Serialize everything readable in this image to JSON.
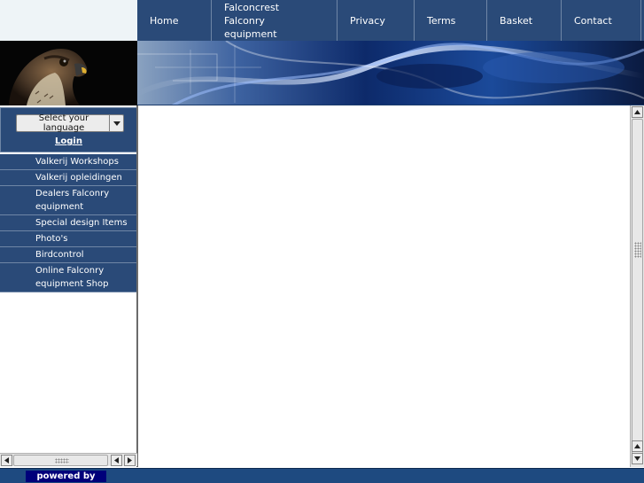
{
  "nav": {
    "items": [
      {
        "label": "Home"
      },
      {
        "label": "Falconcrest Falconry equipment",
        "lines": [
          "Falconcrest",
          "Falconry",
          "equipment"
        ]
      },
      {
        "label": "Privacy"
      },
      {
        "label": "Terms"
      },
      {
        "label": "Basket"
      },
      {
        "label": "Contact"
      }
    ]
  },
  "language": {
    "select_label": "Select your language",
    "login_label": "Login"
  },
  "sidebar": {
    "items": [
      {
        "label": "Valkerij Workshops"
      },
      {
        "label": "Valkerij opleidingen"
      },
      {
        "label": "Dealers Falconry equipment"
      },
      {
        "label": "Special design Items"
      },
      {
        "label": "Photo's"
      },
      {
        "label": "Birdcontrol"
      },
      {
        "label": "Online Falconry equipment Shop"
      }
    ]
  },
  "footer": {
    "powered_by": "powered by"
  },
  "colors": {
    "nav_bg": "#2a4a78",
    "footer_bg": "#1e4a80",
    "powered_bg": "#00007a",
    "divider": "#6f86a6"
  }
}
